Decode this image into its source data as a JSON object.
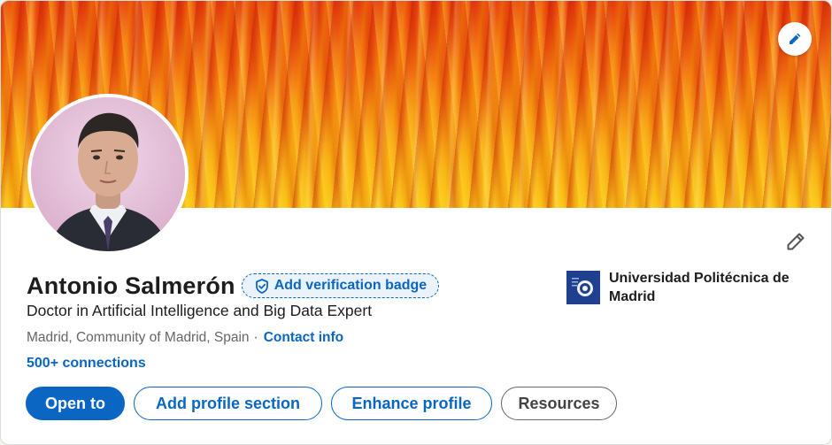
{
  "profile": {
    "name": "Antonio Salmerón",
    "verification_badge_label": "Add verification badge",
    "headline": "Doctor in Artificial Intelligence and Big Data Expert",
    "location": "Madrid, Community of Madrid, Spain",
    "separator": "·",
    "contact_info_label": "Contact info",
    "connections": "500+ connections"
  },
  "education": {
    "organization": "Universidad Politécnica de Madrid"
  },
  "actions": {
    "open_to": "Open to",
    "add_profile_section": "Add profile section",
    "enhance_profile": "Enhance profile",
    "resources": "Resources"
  },
  "icons": {
    "banner_edit": "pencil-icon",
    "profile_edit": "pencil-icon",
    "verify": "shield-check-icon"
  },
  "colors": {
    "accent": "#0a66c2",
    "text": "#1d1d1d",
    "secondary_text": "#666666"
  }
}
